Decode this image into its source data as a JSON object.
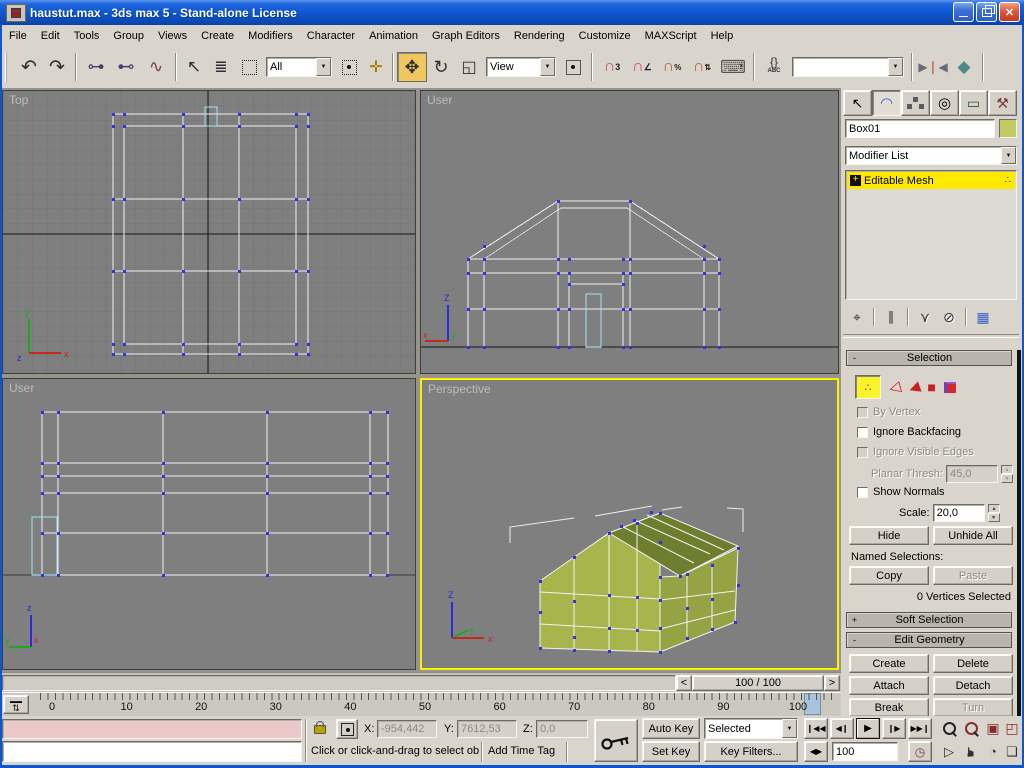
{
  "window": {
    "title": "haustut.max - 3ds max 5 - Stand-alone License"
  },
  "menubar": {
    "items": [
      "File",
      "Edit",
      "Tools",
      "Group",
      "Views",
      "Create",
      "Modifiers",
      "Character",
      "Animation",
      "Graph Editors",
      "Rendering",
      "Customize",
      "MAXScript",
      "Help"
    ]
  },
  "toolbar": {
    "selection_filter_value": "All",
    "coord_system_value": "View",
    "named_sets_value": ""
  },
  "viewports": {
    "top": {
      "label": "Top"
    },
    "front": {
      "label": "User"
    },
    "side": {
      "label": "User"
    },
    "perspective": {
      "label": "Perspective"
    }
  },
  "panel": {
    "object_name": "Box01",
    "modifier_list": "Modifier List",
    "stack_item": "Editable Mesh",
    "selection": {
      "title": "Selection",
      "collapse": "-",
      "by_vertex": "By Vertex",
      "ignore_backfacing": "Ignore Backfacing",
      "ignore_visible_edges": "Ignore Visible Edges",
      "planar_thresh_label": "Planar Thresh:",
      "planar_thresh_value": "45,0",
      "show_normals": "Show Normals",
      "scale_label": "Scale:",
      "scale_value": "20,0",
      "hide": "Hide",
      "unhide_all": "Unhide All",
      "named_selections": "Named Selections:",
      "copy": "Copy",
      "paste": "Paste",
      "status": "0 Vertices Selected"
    },
    "soft_selection": {
      "title": "Soft Selection",
      "collapse": "+"
    },
    "edit_geometry": {
      "title": "Edit Geometry",
      "collapse": "-",
      "create": "Create",
      "delete": "Delete",
      "attach": "Attach",
      "detach": "Detach",
      "break_btn": "Break",
      "turn": "Turn"
    }
  },
  "timeline": {
    "prev": "<",
    "next": ">",
    "slider_label": "100 / 100",
    "ticks": [
      "0",
      "10",
      "20",
      "30",
      "40",
      "50",
      "60",
      "70",
      "80",
      "90",
      "100"
    ]
  },
  "status": {
    "prompt": "Click or click-and-drag to select obj",
    "add_time_tag": "Add Time Tag",
    "x_label": "X:",
    "x_value": "-954,442",
    "y_label": "Y:",
    "y_value": "7612,53",
    "z_label": "Z:",
    "z_value": "0,0",
    "auto_key": "Auto Key",
    "set_key": "Set Key",
    "key_mode_value": "Selected",
    "key_filters": "Key Filters...",
    "frame_value": "100"
  },
  "colors": {
    "titlebar": "#0F5BD5",
    "active_viewport_border": "#FBF200",
    "stack_highlight": "#FFE900",
    "object_swatch": "#C2CB63",
    "house_front": "#A8B54D",
    "house_roof": "#6F7D2F",
    "vertex_blue": "#3333DD",
    "door_cyan": "#9FE4F4",
    "listener_pink": "#EBC9C9"
  },
  "icons": {
    "undo": "↶",
    "redo": "↷",
    "link": "⊶",
    "unlink": "⊷",
    "bind_spacewarp": "∿",
    "select": "↖",
    "select_by_name": "≣",
    "manipulate": "✛",
    "move": "✥",
    "rotate": "↻",
    "scale": "◱",
    "magnet": "∩",
    "snap3_sub": "3",
    "angle_sub": "∠",
    "percent_sub": "%",
    "spinner_sub": "⇅",
    "keyboard_override": "⌨",
    "named_sel_braces": "{}",
    "named_sel_abc": "ABC",
    "mirror_left": "▶",
    "mirror_bar": "❘",
    "mirror_right": "◀",
    "align": "◆",
    "dd_arrow": "▼",
    "minimize": "—",
    "close": "✕",
    "tab_create": "↖",
    "tab_modify": "◠",
    "tab_motion": "◎",
    "tab_display": "▭",
    "tab_utilities": "⚒",
    "pin": "⌖",
    "show_end": "∥",
    "make_unique": "⋎",
    "remove_mod": "⊘",
    "config_sets": "▦",
    "plus": "+",
    "vertex_dots": "∴",
    "edge": "◁",
    "face": "◀",
    "polygon": "■",
    "go_start": "❙◀◀",
    "prev_frame": "◀❙",
    "play": "▶",
    "next_frame": "❙▶",
    "go_end": "▶▶❙",
    "key_mode": "◀▶",
    "time_config": "◷",
    "zoom_extents": "▣",
    "zoom_extents_all": "◰",
    "fov": "▷",
    "pan": "☛",
    "arc_rotate": "◔",
    "min_max": "❏",
    "curve_editor": "⇅",
    "lock": "",
    "key": ""
  }
}
